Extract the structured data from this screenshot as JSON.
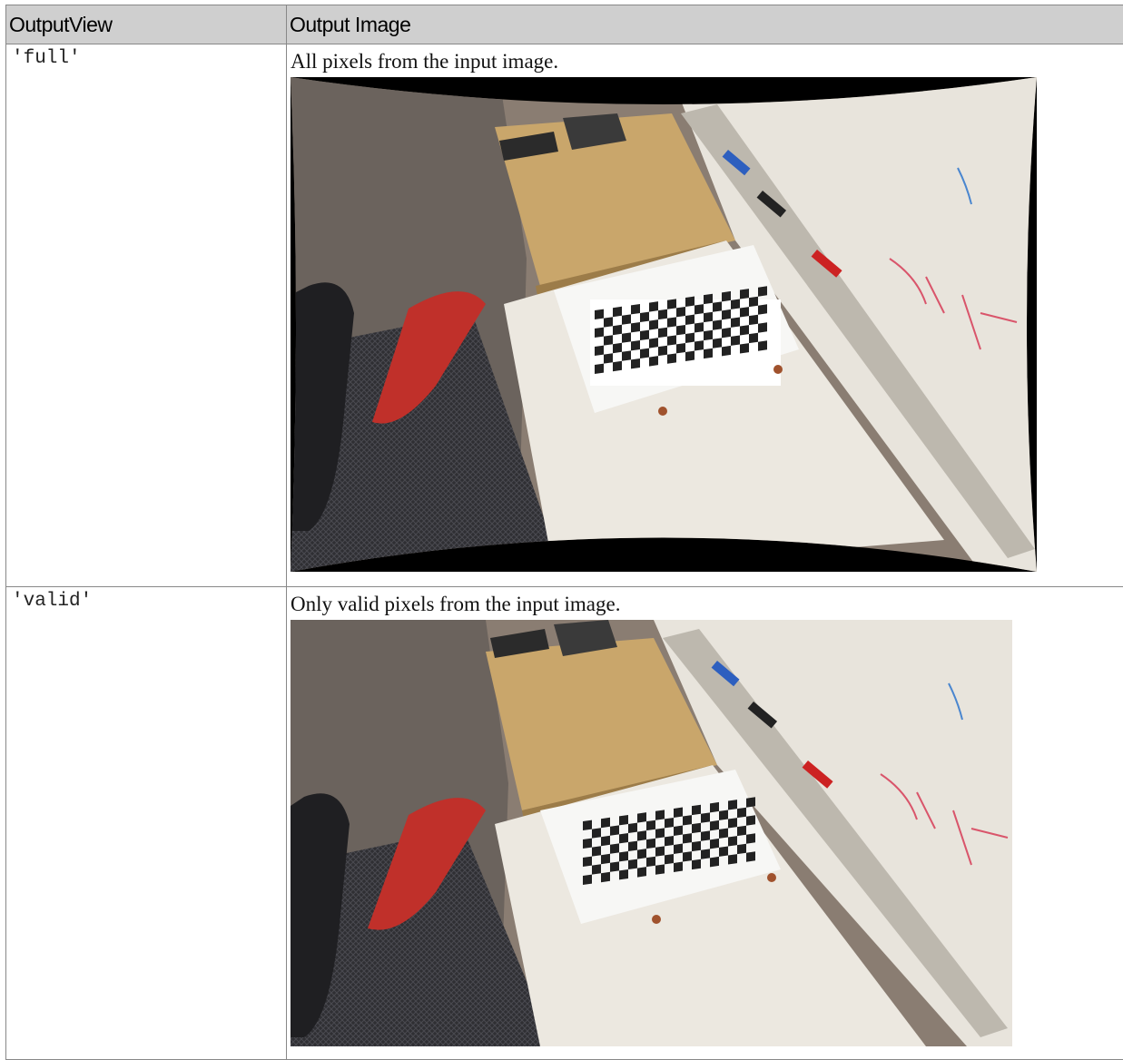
{
  "table": {
    "headers": [
      "OutputView",
      "Output Image"
    ],
    "rows": [
      {
        "view": "'full'",
        "description": "All pixels from the input image.",
        "image": "full-undistorted-photo"
      },
      {
        "view": "'valid'",
        "description": "Only valid pixels from the input image.",
        "image": "valid-undistorted-photo"
      }
    ]
  }
}
